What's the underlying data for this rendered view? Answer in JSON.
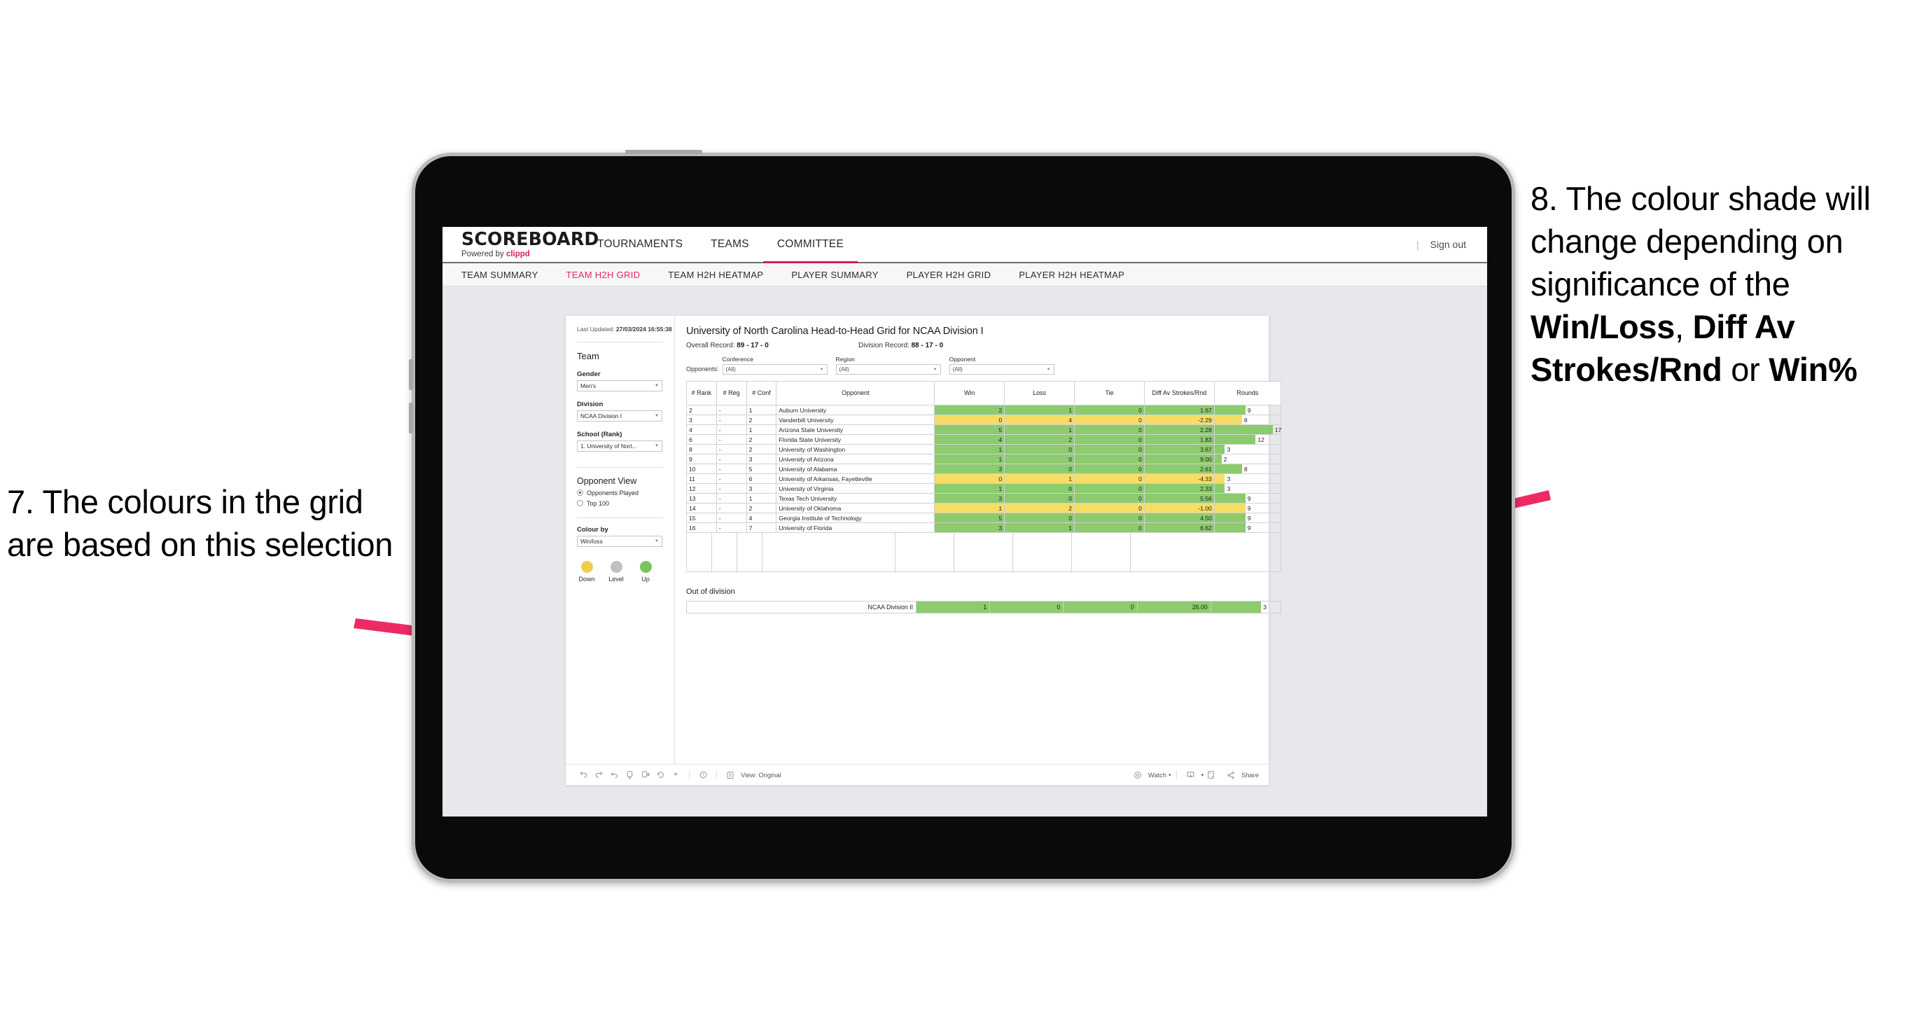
{
  "annotations": {
    "left": {
      "name": "annotation-7",
      "text": "7. The colours in the grid are based on this selection"
    },
    "right": {
      "name": "annotation-8",
      "prefix": "8. The colour shade will change depending on significance of the ",
      "bold1": "Win/Loss",
      "mid1": ", ",
      "bold2": "Diff Av Strokes/Rnd",
      "mid2": " or ",
      "bold3": "Win%"
    },
    "arrow_color": "#ED2A63"
  },
  "header": {
    "brand_main": "SCOREBOARD",
    "brand_sub_prefix": "Powered by ",
    "brand_sub_accent": "clippd",
    "nav": [
      {
        "label": "TOURNAMENTS",
        "active": false
      },
      {
        "label": "TEAMS",
        "active": false
      },
      {
        "label": "COMMITTEE",
        "active": true
      }
    ],
    "divider": "|",
    "signout": "Sign out",
    "accent_color": "#d81f52"
  },
  "subnav": [
    {
      "label": "TEAM SUMMARY",
      "active": false
    },
    {
      "label": "TEAM H2H GRID",
      "active": true
    },
    {
      "label": "TEAM H2H HEATMAP",
      "active": false
    },
    {
      "label": "PLAYER SUMMARY",
      "active": false
    },
    {
      "label": "PLAYER H2H GRID",
      "active": false
    },
    {
      "label": "PLAYER H2H HEATMAP",
      "active": false
    }
  ],
  "filters": {
    "updated_label": "Last Updated: ",
    "updated_value": "27/03/2024 16:55:38",
    "team_title": "Team",
    "gender_label": "Gender",
    "gender_value": "Men's",
    "division_label": "Division",
    "division_value": "NCAA Division I",
    "school_label": "School (Rank)",
    "school_value": "1. University of Nort...",
    "opponent_view_title": "Opponent View",
    "radio_played": "Opponents Played",
    "radio_top100": "Top 100",
    "colour_by_label": "Colour by",
    "colour_by_value": "Win/loss",
    "legend": [
      {
        "caption": "Down",
        "color": "#F2CC4E"
      },
      {
        "caption": "Level",
        "color": "#BFC0C2"
      },
      {
        "caption": "Up",
        "color": "#7DC35C"
      }
    ]
  },
  "viz": {
    "title": "University of North Carolina Head-to-Head Grid for NCAA Division I",
    "overall_label": "Overall Record: ",
    "overall_value": "89 - 17 - 0",
    "division_label": "Division Record: ",
    "division_value": "88 - 17 - 0",
    "opponents_lead": "Opponents:",
    "opp_filters": [
      {
        "label": "Conference",
        "value": "(All)"
      },
      {
        "label": "Region",
        "value": "(All)"
      },
      {
        "label": "Opponent",
        "value": "(All)"
      }
    ]
  },
  "chart_data": {
    "type": "table",
    "title": "University of North Carolina Head-to-Head Grid for NCAA Division I",
    "columns": [
      "# Rank",
      "# Reg",
      "# Conf",
      "Opponent",
      "Win",
      "Loss",
      "Tie",
      "Diff Av Strokes/Rnd",
      "Rounds"
    ],
    "colour_by": "Win/loss",
    "colors": {
      "up": "#8CCB6E",
      "down": "#F5DD66",
      "level": "#BFC0C2"
    },
    "rounds_max": 17,
    "rows": [
      {
        "rank": "2",
        "reg": "-",
        "conf": "1",
        "opponent": "Auburn University",
        "win": "2",
        "loss": "1",
        "tie": "0",
        "diff": "1.67",
        "rounds": "9",
        "state": "up"
      },
      {
        "rank": "3",
        "reg": "-",
        "conf": "2",
        "opponent": "Vanderbilt University",
        "win": "0",
        "loss": "4",
        "tie": "0",
        "diff": "-2.29",
        "rounds": "8",
        "state": "down"
      },
      {
        "rank": "4",
        "reg": "-",
        "conf": "1",
        "opponent": "Arizona State University",
        "win": "5",
        "loss": "1",
        "tie": "0",
        "diff": "2.28",
        "rounds": "17",
        "state": "up"
      },
      {
        "rank": "6",
        "reg": "-",
        "conf": "2",
        "opponent": "Florida State University",
        "win": "4",
        "loss": "2",
        "tie": "0",
        "diff": "1.83",
        "rounds": "12",
        "state": "up"
      },
      {
        "rank": "8",
        "reg": "-",
        "conf": "2",
        "opponent": "University of Washington",
        "win": "1",
        "loss": "0",
        "tie": "0",
        "diff": "3.67",
        "rounds": "3",
        "state": "up"
      },
      {
        "rank": "9",
        "reg": "-",
        "conf": "3",
        "opponent": "University of Arizona",
        "win": "1",
        "loss": "0",
        "tie": "0",
        "diff": "9.00",
        "rounds": "2",
        "state": "up"
      },
      {
        "rank": "10",
        "reg": "-",
        "conf": "5",
        "opponent": "University of Alabama",
        "win": "3",
        "loss": "0",
        "tie": "0",
        "diff": "2.61",
        "rounds": "8",
        "state": "up"
      },
      {
        "rank": "11",
        "reg": "-",
        "conf": "6",
        "opponent": "University of Arkansas, Fayetteville",
        "win": "0",
        "loss": "1",
        "tie": "0",
        "diff": "-4.33",
        "rounds": "3",
        "state": "down"
      },
      {
        "rank": "12",
        "reg": "-",
        "conf": "3",
        "opponent": "University of Virginia",
        "win": "1",
        "loss": "0",
        "tie": "0",
        "diff": "2.33",
        "rounds": "3",
        "state": "up"
      },
      {
        "rank": "13",
        "reg": "-",
        "conf": "1",
        "opponent": "Texas Tech University",
        "win": "3",
        "loss": "0",
        "tie": "0",
        "diff": "5.56",
        "rounds": "9",
        "state": "up"
      },
      {
        "rank": "14",
        "reg": "-",
        "conf": "2",
        "opponent": "University of Oklahoma",
        "win": "1",
        "loss": "2",
        "tie": "0",
        "diff": "-1.00",
        "rounds": "9",
        "state": "down"
      },
      {
        "rank": "15",
        "reg": "-",
        "conf": "4",
        "opponent": "Georgia Institute of Technology",
        "win": "5",
        "loss": "0",
        "tie": "0",
        "diff": "4.50",
        "rounds": "9",
        "state": "up"
      },
      {
        "rank": "16",
        "reg": "-",
        "conf": "7",
        "opponent": "University of Florida",
        "win": "3",
        "loss": "1",
        "tie": "0",
        "diff": "6.62",
        "rounds": "9",
        "state": "up"
      }
    ],
    "out_of_division": {
      "title": "Out of division",
      "rows": [
        {
          "name": "NCAA Division II",
          "win": "1",
          "loss": "0",
          "tie": "0",
          "diff": "26.00",
          "rounds": "3",
          "state": "up"
        }
      ]
    }
  },
  "toolbar": {
    "view_label": "View: Original",
    "watch_label": "Watch",
    "share_label": "Share",
    "caret": "▾"
  }
}
